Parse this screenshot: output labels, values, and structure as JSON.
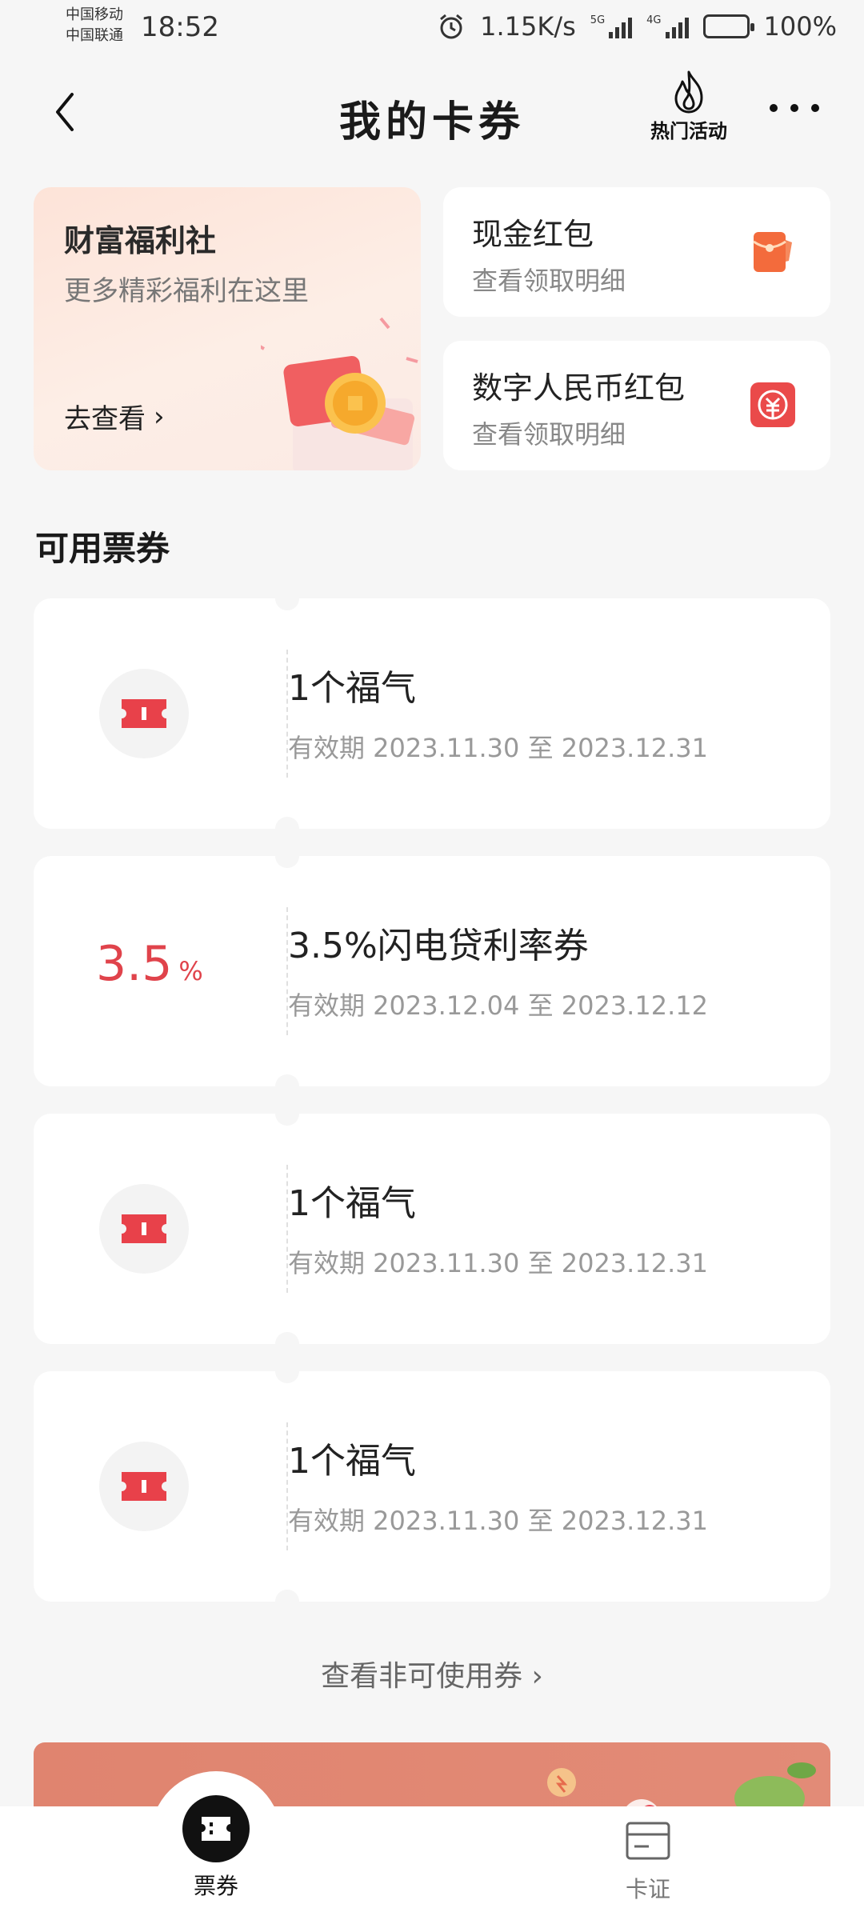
{
  "status_bar": {
    "carrier_1": "中国移动",
    "carrier_2": "中国联通",
    "time": "18:52",
    "net_speed": "1.15K/s",
    "net_1": "5G",
    "net_2": "4G",
    "battery": "100%",
    "battery_level": 1.0
  },
  "nav": {
    "title": "我的卡券",
    "hot_label": "热门活动"
  },
  "welfare": {
    "title": "财富福利社",
    "subtitle": "更多精彩福利在这里",
    "link": "去查看",
    "chevron": "›"
  },
  "side_cards": [
    {
      "title": "现金红包",
      "subtitle": "查看领取明细",
      "icon": "red-envelope-icon",
      "color": "#f36b3c"
    },
    {
      "title": "数字人民币红包",
      "subtitle": "查看领取明细",
      "icon": "digital-rmb-icon",
      "color": "#ea4a4a"
    }
  ],
  "section_title": "可用票券",
  "coupons": [
    {
      "name": "1个福气",
      "validity": "有效期 2023.11.30 至 2023.12.31",
      "icon": "ticket-icon"
    },
    {
      "name": "3.5%闪电贷利率券",
      "validity": "有效期 2023.12.04 至 2023.12.12",
      "rate_value": "3.5",
      "rate_unit": "%"
    },
    {
      "name": "1个福气",
      "validity": "有效期 2023.11.30 至 2023.12.31",
      "icon": "ticket-icon"
    },
    {
      "name": "1个福气",
      "validity": "有效期 2023.11.30 至 2023.12.31",
      "icon": "ticket-icon"
    }
  ],
  "view_invalid": "查看非可使用券 ›",
  "tabbar": {
    "tickets": "票券",
    "cards": "卡证"
  },
  "colors": {
    "accent_red": "#e0434b",
    "background": "#f6f6f6"
  }
}
